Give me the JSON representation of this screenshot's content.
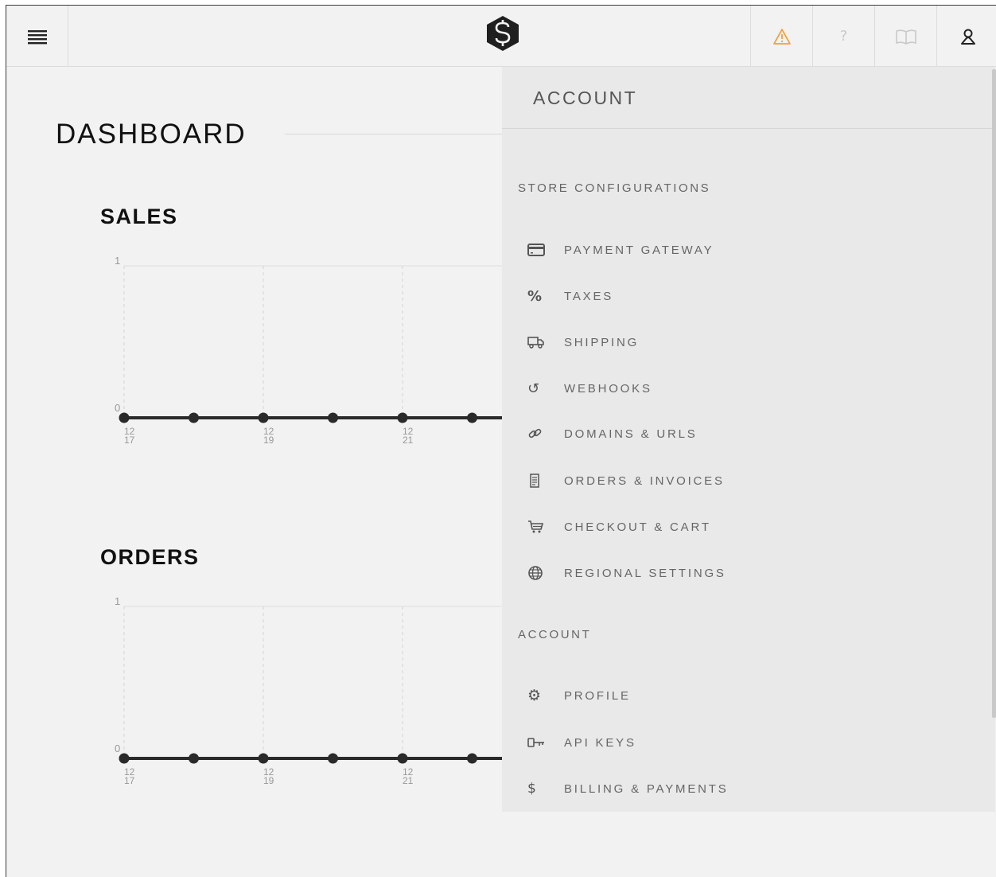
{
  "topbar": {
    "menu_icon": "hamburger-icon",
    "logo_icon": "dollar-hexagon-logo",
    "actions": [
      {
        "icon": "warning-icon",
        "color": "#f0a13c"
      },
      {
        "icon": "help-icon",
        "glyph": "?"
      },
      {
        "icon": "book-icon"
      },
      {
        "icon": "user-icon"
      }
    ]
  },
  "dashboard": {
    "title": "DASHBOARD"
  },
  "charts": [
    {
      "title": "SALES"
    },
    {
      "title": "ORDERS"
    }
  ],
  "chart_data": [
    {
      "type": "line",
      "title": "SALES",
      "ylim": [
        0,
        1
      ],
      "y_ticks": [
        "1",
        "0"
      ],
      "x_tick_labels": [
        [
          "12",
          "17"
        ],
        [
          "12",
          "19"
        ],
        [
          "12",
          "21"
        ]
      ],
      "x": [
        "12/17",
        "12/18",
        "12/19",
        "12/20",
        "12/21",
        "12/22"
      ],
      "values": [
        0,
        0,
        0,
        0,
        0,
        0
      ],
      "grid": "vertical dashed"
    },
    {
      "type": "line",
      "title": "ORDERS",
      "ylim": [
        0,
        1
      ],
      "y_ticks": [
        "1",
        "0"
      ],
      "x_tick_labels": [
        [
          "12",
          "17"
        ],
        [
          "12",
          "19"
        ],
        [
          "12",
          "21"
        ]
      ],
      "x": [
        "12/17",
        "12/18",
        "12/19",
        "12/20",
        "12/21",
        "12/22"
      ],
      "values": [
        0,
        0,
        0,
        0,
        0,
        0
      ],
      "grid": "vertical dashed"
    }
  ],
  "panel": {
    "title": "ACCOUNT",
    "store_group": {
      "title": "STORE CONFIGURATIONS",
      "items": [
        {
          "label": "PAYMENT GATEWAY",
          "icon": "credit-card-icon"
        },
        {
          "label": "TAXES",
          "icon": "percent-icon",
          "glyph": "%"
        },
        {
          "label": "SHIPPING",
          "icon": "truck-icon"
        },
        {
          "label": "WEBHOOKS",
          "icon": "undo-arrow-icon",
          "glyph": "↺"
        },
        {
          "label": "DOMAINS & URLS",
          "icon": "link-icon"
        },
        {
          "label": "ORDERS & INVOICES",
          "icon": "receipt-icon"
        },
        {
          "label": "CHECKOUT & CART",
          "icon": "cart-icon"
        },
        {
          "label": "REGIONAL SETTINGS",
          "icon": "globe-icon"
        }
      ]
    },
    "account_group": {
      "title": "ACCOUNT",
      "items": [
        {
          "label": "PROFILE",
          "icon": "cog-icon",
          "glyph": "⚙"
        },
        {
          "label": "API KEYS",
          "icon": "key-icon"
        },
        {
          "label": "BILLING & PAYMENTS",
          "icon": "dollar-icon",
          "glyph": "$"
        }
      ]
    }
  }
}
